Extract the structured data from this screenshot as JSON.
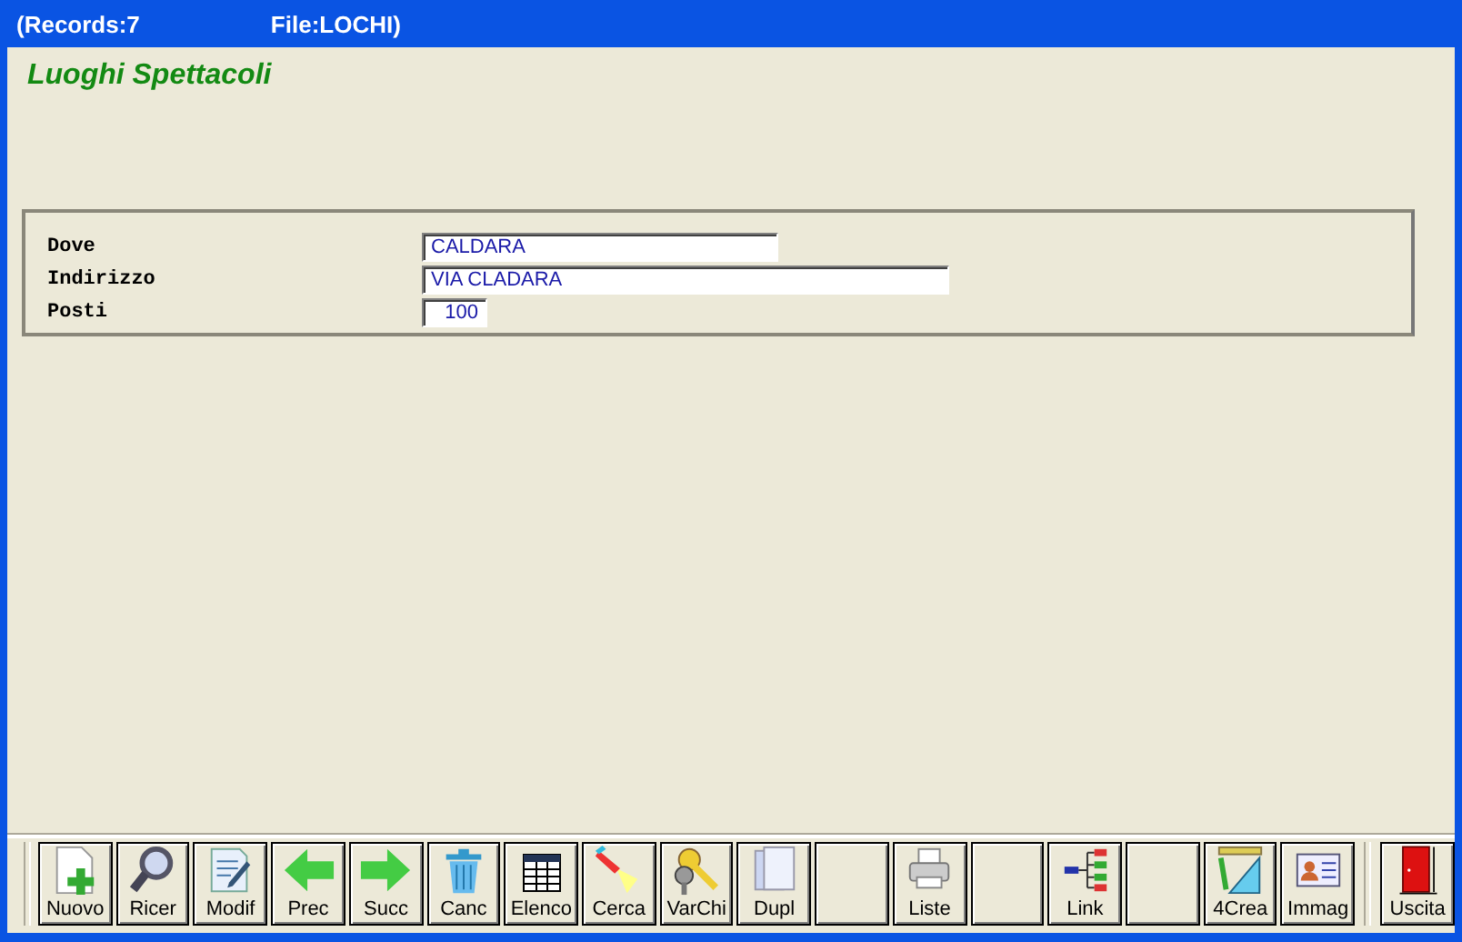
{
  "window": {
    "title_records": "(Records:7",
    "title_file": "File:LOCHI)"
  },
  "heading": "Luoghi Spettacoli",
  "fields": [
    {
      "label": "Dove",
      "value": "CALDARA",
      "kind": "medium"
    },
    {
      "label": "Indirizzo",
      "value": "VIA CLADARA",
      "kind": "wide"
    },
    {
      "label": "Posti",
      "value": "100",
      "kind": "number"
    }
  ],
  "toolbar": [
    {
      "kind": "button",
      "label": "Nuovo"
    },
    {
      "kind": "button",
      "label": "Ricer"
    },
    {
      "kind": "button",
      "label": "Modif"
    },
    {
      "kind": "button",
      "label": "Prec"
    },
    {
      "kind": "button",
      "label": "Succ"
    },
    {
      "kind": "button",
      "label": "Canc"
    },
    {
      "kind": "button",
      "label": "Elenco"
    },
    {
      "kind": "button",
      "label": "Cerca"
    },
    {
      "kind": "button",
      "label": "VarChi"
    },
    {
      "kind": "button",
      "label": "Dupl"
    },
    {
      "kind": "blank"
    },
    {
      "kind": "button",
      "label": "Liste"
    },
    {
      "kind": "blank"
    },
    {
      "kind": "button",
      "label": "Link"
    },
    {
      "kind": "blank"
    },
    {
      "kind": "button",
      "label": "4Crea"
    },
    {
      "kind": "button",
      "label": "Immag"
    },
    {
      "kind": "exit",
      "label": "Uscita"
    }
  ]
}
